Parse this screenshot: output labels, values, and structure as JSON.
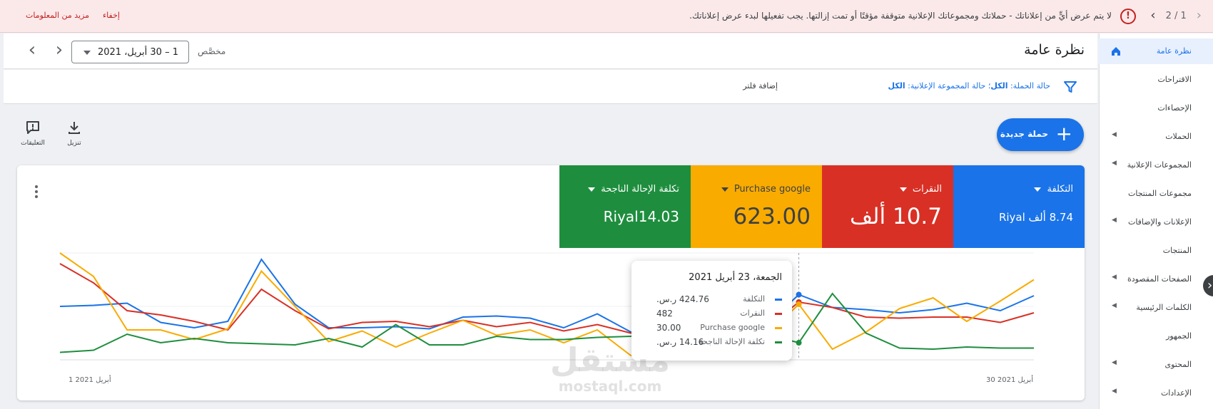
{
  "alert": {
    "pager": "2 / 1",
    "message": "لا يتم عرض أيٍّ من إعلاناتك - حملاتك ومجموعاتك الإعلانية متوقفة مؤقتًا أو تمت إزالتها. يجب تفعيلها لبدء عرض إعلاناتك.",
    "hide": "إخفاء",
    "more_info": "مزيد من المعلومات"
  },
  "sidebar": {
    "items": [
      {
        "label": "نظرة عامة",
        "active": true
      },
      {
        "label": "الاقتراحات"
      },
      {
        "label": "الإحصاءات"
      },
      {
        "label": "الحملات",
        "arrow": true
      },
      {
        "label": "المجموعات الإعلانية",
        "arrow": true
      },
      {
        "label": "مجموعات المنتجات"
      },
      {
        "label": "الإعلانات والإضافات",
        "arrow": true
      },
      {
        "label": "المنتجات"
      },
      {
        "label": "الصفحات المقصودة",
        "arrow": true
      },
      {
        "label": "الكلمات الرئيسية",
        "arrow": true
      },
      {
        "label": "الجمهور"
      },
      {
        "label": "المحتوى",
        "arrow": true
      },
      {
        "label": "الإعدادات",
        "arrow": true
      }
    ]
  },
  "header": {
    "title": "نظرة عامة",
    "date_range": "1 – 30 أبريل، 2021",
    "custom": "مخصَّص"
  },
  "filter": {
    "campaign_status_label": "حالة الحملة: ",
    "campaign_status_value": "الكل",
    "adgroup_status_label": "؛ حالة المجموعة الإعلانية: ",
    "adgroup_status_value": "الكل",
    "add_filter": "إضافة فلتر"
  },
  "actions": {
    "new_campaign": "حملة جديدة",
    "download": "تنزيل",
    "feedback": "التعليقات"
  },
  "metrics": [
    {
      "label": "التكلفة",
      "value": "8.74 ألف Riyal",
      "color": "#1a73e8"
    },
    {
      "label": "النقرات",
      "value": "10.7 ألف",
      "color": "#d93025"
    },
    {
      "label": "Purchase google",
      "value": "623.00",
      "color": "#f9ab00"
    },
    {
      "label": "تكلفة الإحالة الناجحة",
      "value": "Riyal14.03",
      "color": "#1e8e3e"
    }
  ],
  "tooltip": {
    "date": "الجمعة، 23 أبريل 2021",
    "rows": [
      {
        "name": "التكلفة",
        "value": "424.76 ر.س.",
        "color": "#1a73e8"
      },
      {
        "name": "النقرات",
        "value": "482",
        "color": "#d93025"
      },
      {
        "name": "Purchase google",
        "value": "30.00",
        "color": "#f9ab00"
      },
      {
        "name": "تكلفة الإحالة الناجحة",
        "value": "14.16 ر.س.",
        "color": "#1e8e3e"
      }
    ]
  },
  "chart_data": {
    "type": "line",
    "x_start_label": "1 أبريل 2021",
    "x_end_label": "30 أبريل 2021",
    "grid": true,
    "normalized": true,
    "highlight_index": 22,
    "series": [
      {
        "name": "التكلفة",
        "color": "#1a73e8",
        "values": [
          0.5,
          0.51,
          0.53,
          0.35,
          0.3,
          0.36,
          0.94,
          0.52,
          0.3,
          0.3,
          0.31,
          0.29,
          0.4,
          0.41,
          0.39,
          0.3,
          0.43,
          0.26,
          0.29,
          0.31,
          0.38,
          0.32,
          0.61,
          0.49,
          0.47,
          0.44,
          0.47,
          0.53,
          0.46,
          0.6
        ]
      },
      {
        "name": "النقرات",
        "color": "#d93025",
        "values": [
          0.9,
          0.72,
          0.46,
          0.42,
          0.36,
          0.28,
          0.66,
          0.46,
          0.29,
          0.35,
          0.36,
          0.31,
          0.37,
          0.31,
          0.35,
          0.27,
          0.33,
          0.25,
          0.28,
          0.28,
          0.36,
          0.29,
          0.54,
          0.49,
          0.4,
          0.39,
          0.4,
          0.4,
          0.35,
          0.44
        ]
      },
      {
        "name": "Purchase google",
        "color": "#f9ab00",
        "values": [
          1.0,
          0.78,
          0.28,
          0.28,
          0.19,
          0.29,
          0.83,
          0.5,
          0.17,
          0.27,
          0.12,
          0.25,
          0.37,
          0.23,
          0.28,
          0.16,
          0.28,
          0.04,
          0.1,
          0.14,
          0.22,
          0.22,
          0.52,
          0.1,
          0.26,
          0.48,
          0.58,
          0.36,
          0.55,
          0.75
        ]
      },
      {
        "name": "تكلفة الإحالة الناجحة",
        "color": "#1e8e3e",
        "values": [
          0.07,
          0.09,
          0.24,
          0.16,
          0.2,
          0.16,
          0.15,
          0.14,
          0.2,
          0.12,
          0.33,
          0.14,
          0.14,
          0.22,
          0.19,
          0.19,
          0.21,
          0.22,
          0.29,
          0.25,
          0.23,
          0.24,
          0.16,
          0.62,
          0.25,
          0.11,
          0.1,
          0.12,
          0.11,
          0.11
        ]
      }
    ]
  }
}
